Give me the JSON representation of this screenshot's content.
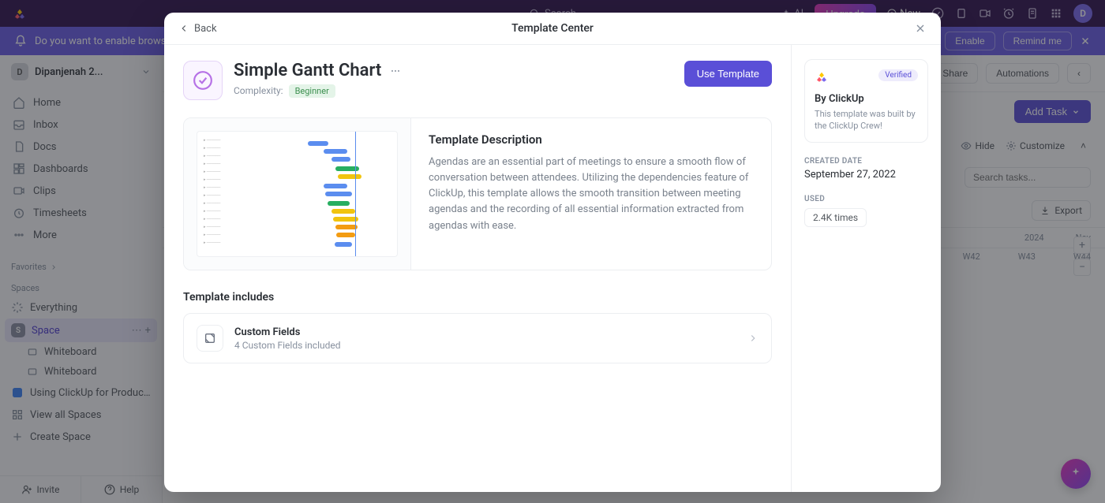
{
  "topnav": {
    "search_placeholder": "Search",
    "ai_label": "AI",
    "upgrade": "Upgrade",
    "new": "New",
    "avatar_initial": "D"
  },
  "banner": {
    "message": "Do you want to enable browser",
    "enable": "Enable",
    "remind": "Remind me"
  },
  "sidebar": {
    "workspace": "Dipanjenah 2...",
    "nav": [
      {
        "label": "Home"
      },
      {
        "label": "Inbox"
      },
      {
        "label": "Docs"
      },
      {
        "label": "Dashboards"
      },
      {
        "label": "Clips"
      },
      {
        "label": "Timesheets"
      },
      {
        "label": "More"
      }
    ],
    "favorites_label": "Favorites",
    "spaces_label": "Spaces",
    "everything_label": "Everything",
    "space_label": "Space",
    "space_initial": "S",
    "wb1": "Whiteboard",
    "wb2": "Whiteboard",
    "using": "Using ClickUp for Productivity",
    "view_all": "View all Spaces",
    "create_space": "Create Space",
    "invite": "Invite",
    "help": "Help"
  },
  "mainbar": {
    "share": "Share",
    "automations": "Automations",
    "addtask": "Add Task",
    "hide": "Hide",
    "customize": "Customize",
    "search_placeholder": "Search tasks...",
    "export": "Export",
    "year": "2024",
    "month": "Nov",
    "weeks": [
      "W42",
      "W43",
      "W44"
    ]
  },
  "modal": {
    "back": "Back",
    "title": "Template Center",
    "template_name": "Simple Gantt Chart",
    "complexity_label": "Complexity:",
    "complexity_value": "Beginner",
    "use": "Use Template",
    "desc_heading": "Template Description",
    "desc_body": "Agendas are an essential part of meetings to ensure a smooth flow of conversation between attendees. Utilizing the dependencies feature of ClickUp, this template allows the smooth transition between meeting agendas and the recording of all essential information extracted from agendas with ease.",
    "includes_heading": "Template includes",
    "include_title": "Custom Fields",
    "include_sub": "4 Custom Fields included",
    "verified": "Verified",
    "by": "By ClickUp",
    "by_sub": "This template was built by the ClickUp Crew!",
    "created_label": "CREATED DATE",
    "created_val": "September 27, 2022",
    "used_label": "USED",
    "used_val": "2.4K times"
  }
}
